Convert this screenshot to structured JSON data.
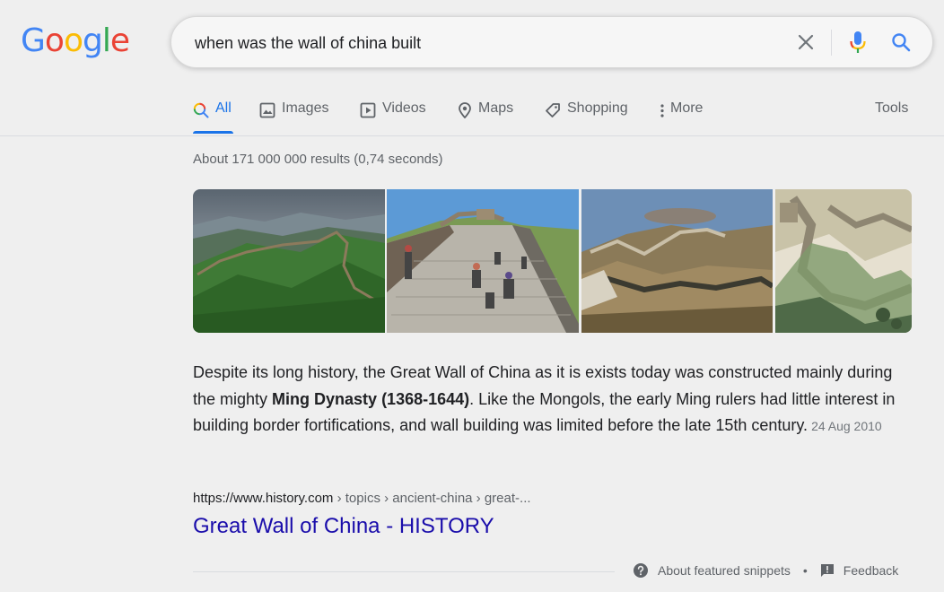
{
  "logo": {
    "letters": [
      "G",
      "o",
      "o",
      "g",
      "l",
      "e"
    ],
    "colors": [
      "#4285F4",
      "#EA4335",
      "#FBBC05",
      "#4285F4",
      "#34A853",
      "#EA4335"
    ]
  },
  "search": {
    "query": "when was the wall of china built",
    "icons": [
      "clear-icon",
      "microphone-icon",
      "search-icon"
    ]
  },
  "tabs": [
    {
      "label": "All",
      "icon": "search-icon",
      "active": true
    },
    {
      "label": "Images",
      "icon": "image-icon"
    },
    {
      "label": "Videos",
      "icon": "video-icon"
    },
    {
      "label": "Maps",
      "icon": "map-pin-icon"
    },
    {
      "label": "Shopping",
      "icon": "tag-icon"
    },
    {
      "label": "More",
      "icon": "more-vert-icon"
    }
  ],
  "tools_label": "Tools",
  "results_count": "About 171 000 000 results (0,74 seconds)",
  "snippet": {
    "text_before": "Despite its long history, the Great Wall of China as it is exists today was constructed mainly during the mighty ",
    "bold": "Ming Dynasty (1368-1644)",
    "text_after": ". Like the Mongols, the early Ming rulers had little interest in building border fortifications, and wall building was limited before the late 15th century.",
    "date": "24 Aug 2010"
  },
  "result": {
    "url_domain": "https://www.history.com",
    "url_path": " › topics › ancient-china › great-...",
    "title": "Great Wall of China - HISTORY"
  },
  "footer": {
    "about_label": "About featured snippets",
    "separator": "•",
    "feedback_label": "Feedback"
  },
  "colors": {
    "accent": "#1a73e8",
    "link": "#1a0dab",
    "background": "#efefef"
  }
}
